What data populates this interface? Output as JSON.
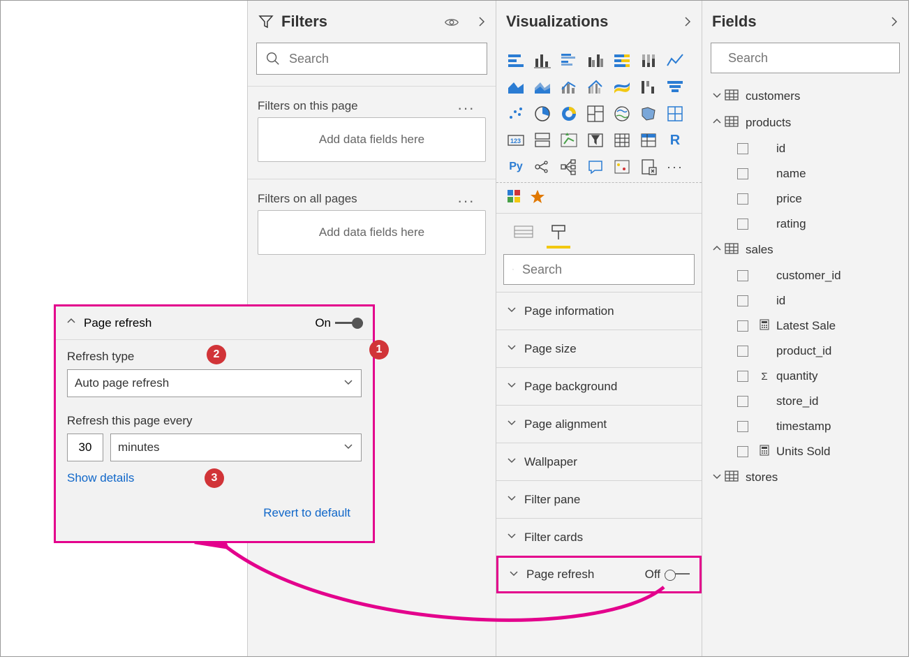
{
  "filters": {
    "title": "Filters",
    "search_placeholder": "Search",
    "page_section": "Filters on this page",
    "all_section": "Filters on all pages",
    "drop_hint": "Add data fields here"
  },
  "viz": {
    "title": "Visualizations",
    "search_placeholder": "Search",
    "groups": [
      "Page information",
      "Page size",
      "Page background",
      "Page alignment",
      "Wallpaper",
      "Filter pane",
      "Filter cards"
    ],
    "refresh_label": "Page refresh",
    "refresh_state": "Off",
    "r_label": "R",
    "py_label": "Py"
  },
  "fields": {
    "title": "Fields",
    "search_placeholder": "Search",
    "tables": [
      {
        "name": "customers",
        "expanded": false
      },
      {
        "name": "products",
        "expanded": true,
        "cols": [
          {
            "name": "id"
          },
          {
            "name": "name"
          },
          {
            "name": "price"
          },
          {
            "name": "rating"
          }
        ]
      },
      {
        "name": "sales",
        "expanded": true,
        "cols": [
          {
            "name": "customer_id"
          },
          {
            "name": "id"
          },
          {
            "name": "Latest Sale",
            "icon": "calc"
          },
          {
            "name": "product_id"
          },
          {
            "name": "quantity",
            "icon": "sum"
          },
          {
            "name": "store_id"
          },
          {
            "name": "timestamp"
          },
          {
            "name": "Units Sold",
            "icon": "calc"
          }
        ]
      },
      {
        "name": "stores",
        "expanded": false
      }
    ]
  },
  "callout": {
    "title": "Page refresh",
    "state": "On",
    "type_label": "Refresh type",
    "type_value": "Auto page refresh",
    "every_label": "Refresh this page every",
    "interval_value": "30",
    "interval_unit": "minutes",
    "show_details": "Show details",
    "revert": "Revert to default",
    "badges": {
      "b1": "1",
      "b2": "2",
      "b3": "3"
    }
  }
}
